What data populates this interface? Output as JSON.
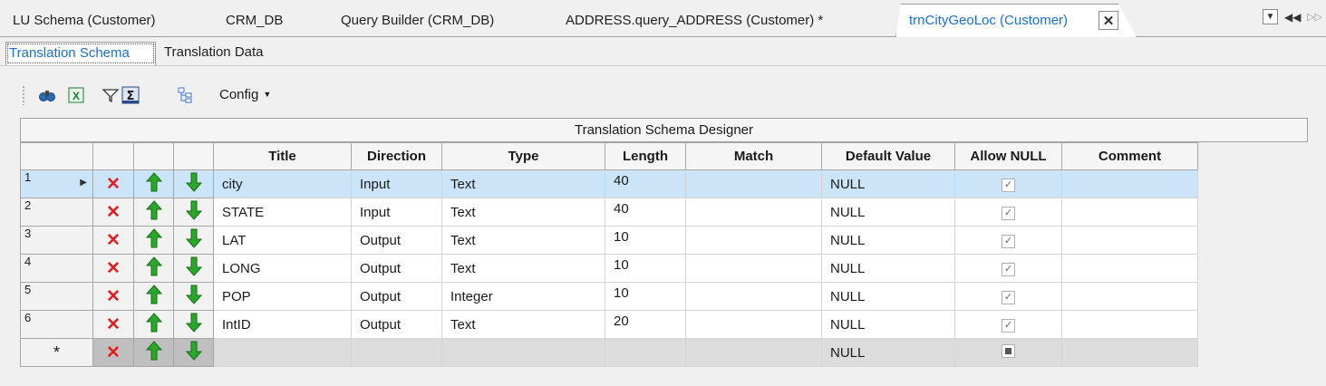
{
  "doc_tabs": [
    {
      "label": "LU Schema (Customer)"
    },
    {
      "label": "CRM_DB"
    },
    {
      "label": "Query Builder (CRM_DB)"
    },
    {
      "label": "ADDRESS.query_ADDRESS (Customer) *"
    },
    {
      "label": "trnCityGeoLoc (Customer)",
      "active": true
    }
  ],
  "sub_tabs": [
    {
      "label": "Translation Schema",
      "selected": true
    },
    {
      "label": "Translation Data"
    }
  ],
  "toolbar": {
    "icons": [
      "find-icon",
      "excel-export-icon",
      "filter-icon",
      "sum-icon",
      "tree-icon"
    ],
    "config_label": "Config"
  },
  "grid": {
    "title": "Translation Schema Designer",
    "columns": [
      "Title",
      "Direction",
      "Type",
      "Length",
      "Match",
      "Default Value",
      "Allow NULL",
      "Comment"
    ],
    "rows": [
      {
        "num": "1",
        "title": "city",
        "direction": "Input",
        "type": "Text",
        "length": "40",
        "match": "",
        "default": "NULL",
        "allow_null": true,
        "comment": ""
      },
      {
        "num": "2",
        "title": "STATE",
        "direction": "Input",
        "type": "Text",
        "length": "40",
        "match": "",
        "default": "NULL",
        "allow_null": true,
        "comment": ""
      },
      {
        "num": "3",
        "title": "LAT",
        "direction": "Output",
        "type": "Text",
        "length": "10",
        "match": "",
        "default": "NULL",
        "allow_null": true,
        "comment": ""
      },
      {
        "num": "4",
        "title": "LONG",
        "direction": "Output",
        "type": "Text",
        "length": "10",
        "match": "",
        "default": "NULL",
        "allow_null": true,
        "comment": ""
      },
      {
        "num": "5",
        "title": "POP",
        "direction": "Output",
        "type": "Integer",
        "length": "10",
        "match": "",
        "default": "NULL",
        "allow_null": true,
        "comment": ""
      },
      {
        "num": "6",
        "title": "IntID",
        "direction": "Output",
        "type": "Text",
        "length": "20",
        "match": "",
        "default": "NULL",
        "allow_null": true,
        "comment": ""
      }
    ],
    "new_row": {
      "marker": "*",
      "default": "NULL"
    },
    "row_icons": {
      "delete": "delete-x-icon",
      "up": "move-up-arrow-icon",
      "down": "move-down-arrow-icon"
    }
  },
  "colors": {
    "active_tab_text": "#1a6fd0",
    "selected_row": "#cce4f7",
    "delete_red": "#e02020",
    "arrow_green": "#2aa82a"
  }
}
